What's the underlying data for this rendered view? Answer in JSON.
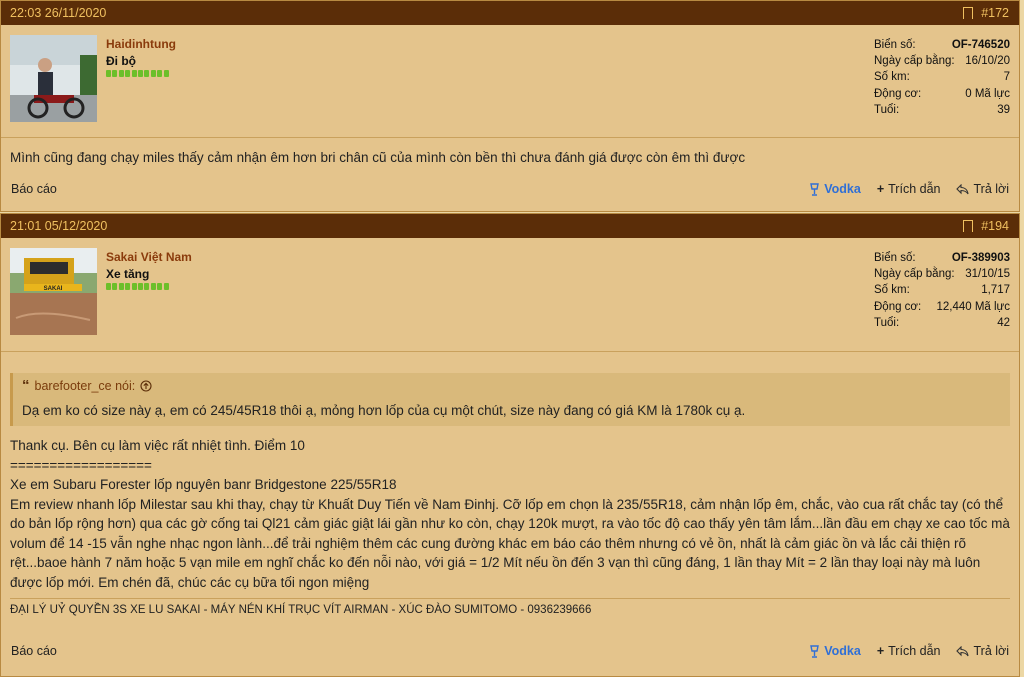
{
  "posts": [
    {
      "time": "22:03 26/11/2020",
      "number": "#172",
      "username": "Haidinhtung",
      "rank": "Đi bộ",
      "stats": [
        {
          "label": "Biển số:",
          "value": "OF-746520"
        },
        {
          "label": "Ngày cấp bằng:",
          "value": "16/10/20"
        },
        {
          "label": "Số km:",
          "value": "7"
        },
        {
          "label": "Động cơ:",
          "value": "0 Mã lực"
        },
        {
          "label": "Tuổi:",
          "value": "39"
        }
      ],
      "text": "Mình cũng đang chạy miles thấy cảm nhận êm hơn bri chân cũ của mình còn bền thì chưa đánh giá được còn êm thì được",
      "report": "Báo cáo",
      "vodka": "Vodka",
      "quote_action": "Trích dẫn",
      "reply_action": "Trả lời"
    },
    {
      "time": "21:01 05/12/2020",
      "number": "#194",
      "username": "Sakai Việt Nam",
      "rank": "Xe tăng",
      "avatar_text": "SAKAI",
      "stats": [
        {
          "label": "Biển số:",
          "value": "OF-389903"
        },
        {
          "label": "Ngày cấp bằng:",
          "value": "31/10/15"
        },
        {
          "label": "Số km:",
          "value": "1,717"
        },
        {
          "label": "Động cơ:",
          "value": "12,440 Mã lực"
        },
        {
          "label": "Tuổi:",
          "value": "42"
        }
      ],
      "quote_author": "barefooter_ce nói:",
      "quote_text": "Dạ em ko có size này ạ, em có 245/45R18 thôi ạ, mỏng hơn lốp của cụ một chút, size này đang có giá KM là 1780k cụ ạ.",
      "lines": [
        "Thank cụ. Bên cụ làm việc rất nhiệt tình. Điểm 10",
        "==================",
        "Xe em Subaru Forester lốp nguyên banr Bridgestone 225/55R18",
        "Em review nhanh lốp Milestar sau khi thay, chạy từ Khuất Duy Tiến về Nam Đinhj. Cỡ lốp em chọn là 235/55R18, cảm nhận lốp êm, chắc, vào cua rất chắc tay (có thể do bản lốp rộng hơn) qua các gờ cống tai Ql21 cảm giác giật lái gần như ko còn, chạy 120k mượt, ra vào tốc độ cao thấy yên tâm lắm...lần đầu em chạy xe cao tốc mà volum để 14 -15 vẫn nghe nhạc ngon lành...để trải nghiệm thêm các cung đường khác em báo cáo thêm nhưng có vẻ ồn, nhất là cảm giác ồn và lắc cải thiện rõ rệt...baoe hành 7 năm hoặc 5 vạn mile em nghĩ chắc ko đến nỗi nào, với giá = 1/2 Mít nếu ồn đến 3 vạn thì cũng đáng, 1 lần thay Mít = 2 lần thay loại này mà luôn được lốp mới. Em chén đã, chúc các cụ bữa tối ngon miệng"
      ],
      "signature": "ĐẠI LÝ UỶ QUYỀN 3S XE LU SAKAI - MÁY NÉN KHÍ TRỤC VÍT AIRMAN - XÚC ĐÀO SUMITOMO - 0936239666",
      "report": "Báo cáo",
      "vodka": "Vodka",
      "quote_action": "Trích dẫn",
      "reply_action": "Trả lời"
    }
  ]
}
